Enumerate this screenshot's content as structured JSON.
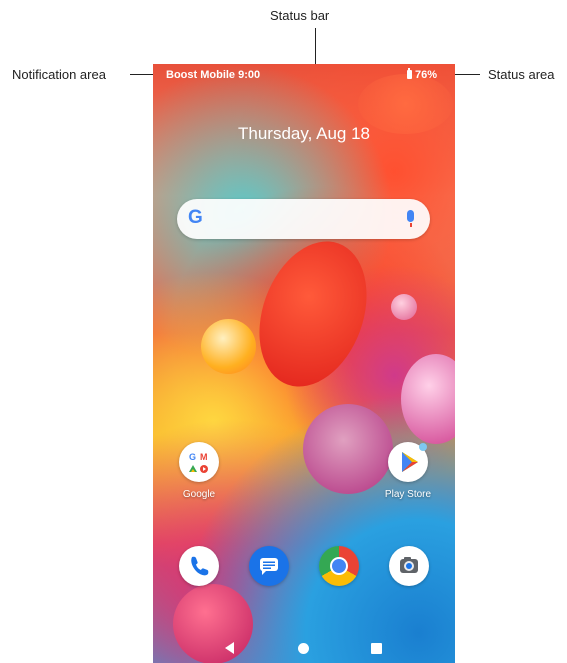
{
  "callouts": {
    "status_bar": "Status bar",
    "notification_area": "Notification area",
    "status_area": "Status area"
  },
  "status_bar": {
    "carrier_time": "Boost Mobile 9:00",
    "battery": "76%"
  },
  "home": {
    "date": "Thursday, Aug 18"
  },
  "search": {
    "logo": "G",
    "icons": [
      "google-g-icon",
      "microphone-icon"
    ]
  },
  "apps": [
    {
      "label": "Google",
      "icon": "google-folder-icon"
    },
    {
      "label": "Play Store",
      "icon": "play-store-icon"
    }
  ],
  "dock": [
    "phone-icon",
    "messages-icon",
    "chrome-icon",
    "camera-icon"
  ],
  "nav": [
    "back-icon",
    "home-icon",
    "recents-icon"
  ],
  "colors": {
    "google_blue": "#4285f4",
    "google_red": "#ea4335",
    "google_yellow": "#fbbc05",
    "google_green": "#34a853",
    "messages_blue": "#1a73e8"
  }
}
